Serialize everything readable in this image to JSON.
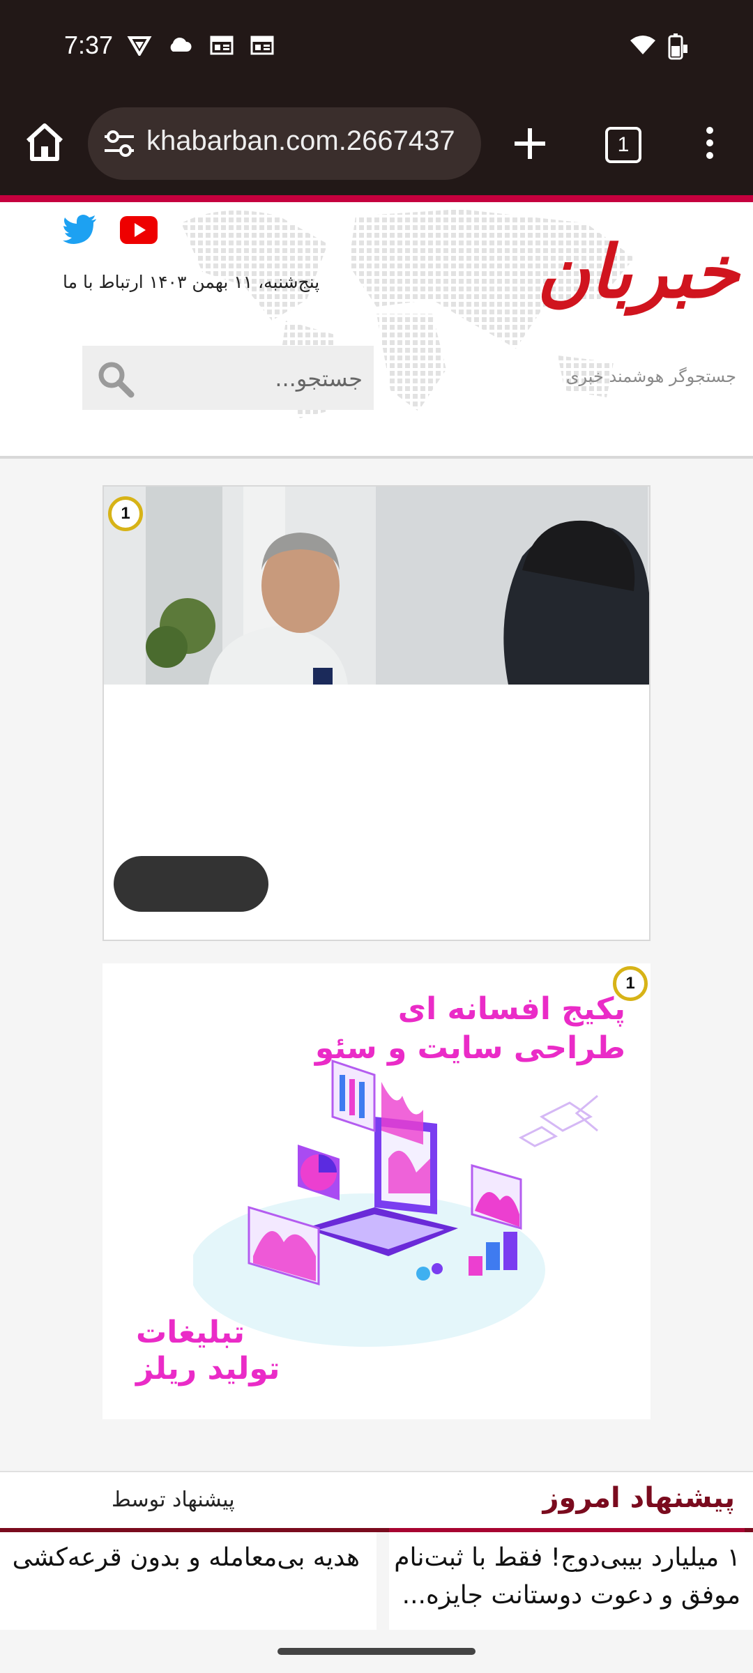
{
  "status_bar": {
    "time": "7:37",
    "icons": [
      "vpn-icon",
      "cloud-icon",
      "news-icon",
      "news-icon",
      "wifi-icon",
      "battery-icon"
    ]
  },
  "browser": {
    "url": "2667437.khabarban.com",
    "tab_count": "1"
  },
  "site": {
    "logo": "خبربان",
    "tagline": "جستجوگر هوشمند خبری",
    "date_line": "پنج‌شنبه، ۱۱ بهمن ۱۴۰۳  ارتباط با ما",
    "search_placeholder": "جستجو...",
    "social": [
      "twitter-icon",
      "youtube-icon"
    ]
  },
  "ads": {
    "badge": "1",
    "ad2_lines": [
      "پکیج افسانه ای",
      "طراحی سایت و سئو"
    ],
    "ad2_bottom": [
      "تبلیغات",
      "تولید ریلز"
    ]
  },
  "news": {
    "tab_today": "پیشنهاد امروز",
    "tab_suggest": "پیشنهاد توسط",
    "items": [
      "۱ میلیارد بیبی‌دوج! فقط با ثبت‌نام موفق و دعوت دوستانت جایزه...",
      "هدیه بی‌معامله و بدون قرعه‌کشی"
    ]
  },
  "colors": {
    "chrome_bg": "#221817",
    "accent": "#c5003e",
    "logo_red": "#d0141e",
    "ad_pink": "#ea2bc7",
    "tab_dark_red": "#7a0b1e"
  }
}
